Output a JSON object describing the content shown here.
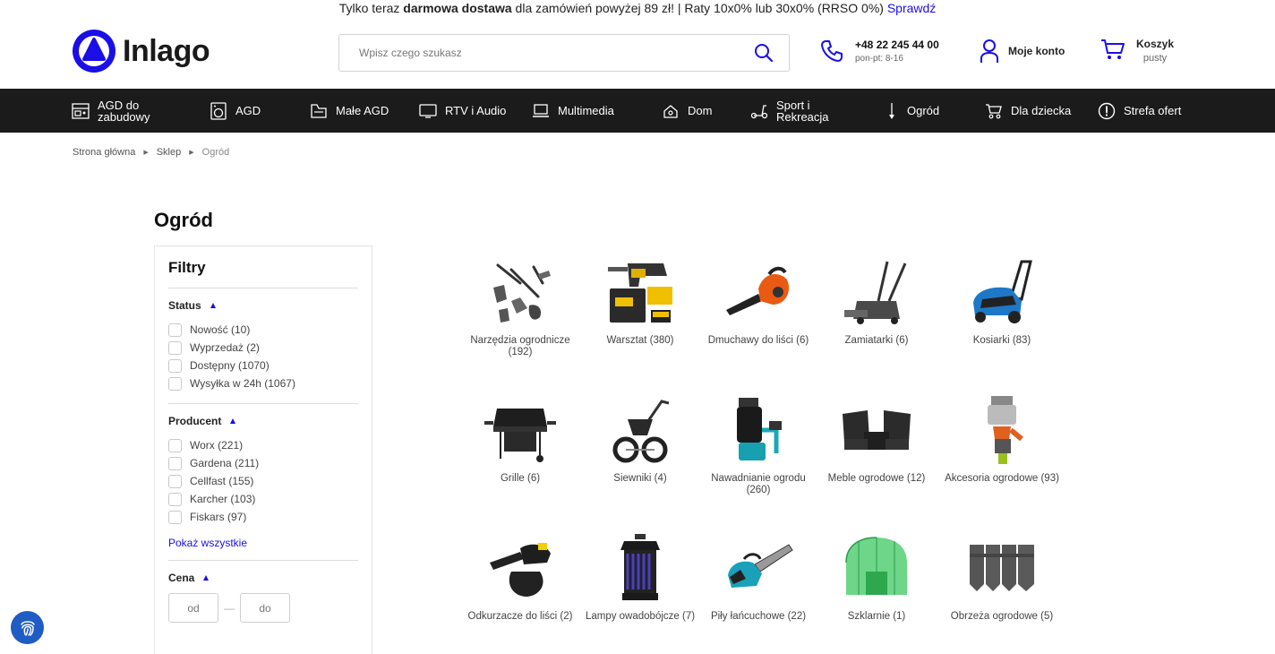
{
  "topbar": {
    "pre": "Tylko teraz ",
    "bold": "darmowa dostawa",
    "post": " dla zamówień powyżej 89 zł! | Raty 10x0% lub 30x0% (RRSO 0%) ",
    "link": "Sprawdź"
  },
  "header": {
    "logo_text": "Inlago",
    "search_placeholder": "Wpisz czego szukasz",
    "phone": "+48 22 245 44 00",
    "hours": "pon-pt: 8-16",
    "account": "Moje konto",
    "cart_title": "Koszyk",
    "cart_status": "pusty"
  },
  "nav": [
    {
      "label": "AGD do zabudowy",
      "icon": "built-in-appliance-icon"
    },
    {
      "label": "AGD",
      "icon": "washing-machine-icon"
    },
    {
      "label": "Małe AGD",
      "icon": "small-appliance-icon"
    },
    {
      "label": "RTV i Audio",
      "icon": "tv-icon"
    },
    {
      "label": "Multimedia",
      "icon": "laptop-icon"
    },
    {
      "label": "Dom",
      "icon": "home-icon"
    },
    {
      "label": "Sport i Rekreacja",
      "icon": "scooter-icon"
    },
    {
      "label": "Ogród",
      "icon": "garden-tool-icon"
    },
    {
      "label": "Dla dziecka",
      "icon": "stroller-icon"
    },
    {
      "label": "Strefa ofert",
      "icon": "alert-circle-icon"
    }
  ],
  "breadcrumb": [
    "Strona główna",
    "Sklep",
    "Ogród"
  ],
  "page_title": "Ogród",
  "filters": {
    "title": "Filtry",
    "status": {
      "title": "Status",
      "options": [
        "Nowość (10)",
        "Wyprzedaż (2)",
        "Dostępny (1070)",
        "Wysyłka w 24h (1067)"
      ]
    },
    "producer": {
      "title": "Producent",
      "options": [
        "Worx (221)",
        "Gardena (211)",
        "Cellfast (155)",
        "Karcher (103)",
        "Fiskars (97)"
      ],
      "show_all": "Pokaż wszystkie"
    },
    "price": {
      "title": "Cena",
      "from_placeholder": "od",
      "to_placeholder": "do",
      "dash": "—"
    }
  },
  "categories": [
    {
      "label": "Narzędzia ogrodnicze (192)",
      "icon": "hand-tools-icon"
    },
    {
      "label": "Warsztat (380)",
      "icon": "power-drill-kit-icon"
    },
    {
      "label": "Dmuchawy do liści (6)",
      "icon": "leaf-blower-icon"
    },
    {
      "label": "Zamiatarki (6)",
      "icon": "sweeper-icon"
    },
    {
      "label": "Kosiarki (83)",
      "icon": "lawn-mower-icon"
    },
    {
      "label": "Grille (6)",
      "icon": "grill-icon"
    },
    {
      "label": "Siewniki (4)",
      "icon": "spreader-icon"
    },
    {
      "label": "Nawadnianie ogrodu (260)",
      "icon": "water-pump-icon"
    },
    {
      "label": "Meble ogrodowe (12)",
      "icon": "garden-furniture-icon"
    },
    {
      "label": "Akcesoria ogrodowe (93)",
      "icon": "hose-connector-icon"
    },
    {
      "label": "Odkurzacze do liści (2)",
      "icon": "leaf-vacuum-icon"
    },
    {
      "label": "Lampy owadobójcze (7)",
      "icon": "insect-lamp-icon"
    },
    {
      "label": "Piły łańcuchowe (22)",
      "icon": "chainsaw-icon"
    },
    {
      "label": "Szklarnie (1)",
      "icon": "greenhouse-icon"
    },
    {
      "label": "Obrzeża ogrodowe (5)",
      "icon": "lawn-edging-icon"
    }
  ],
  "colors": {
    "accent": "#1a0fe6",
    "nav_bg": "#1b1b1b"
  }
}
